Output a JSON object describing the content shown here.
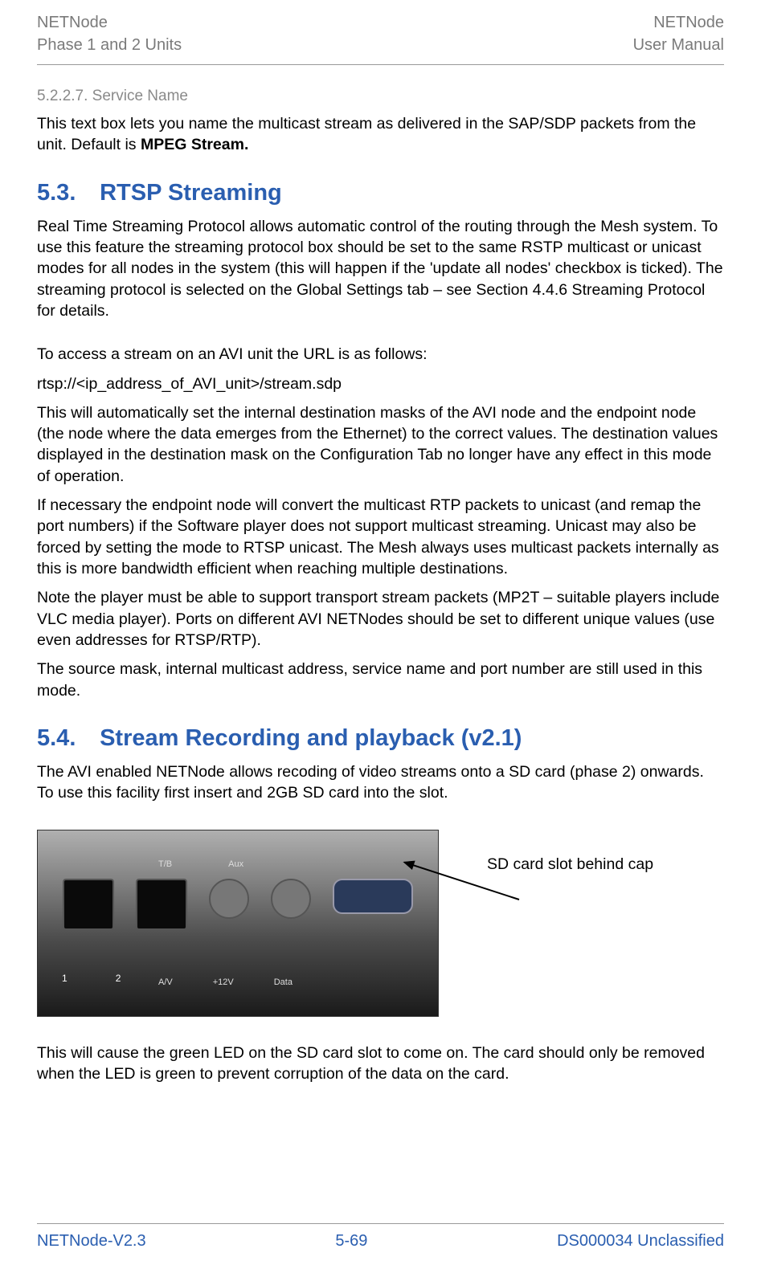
{
  "header": {
    "left_line1": "NETNode",
    "left_line2": "Phase 1 and 2 Units",
    "right_line1": "NETNode",
    "right_line2": "User Manual"
  },
  "sections": {
    "s52227": {
      "number": "5.2.2.7.",
      "title": "Service Name",
      "body": "This text box lets you name the multicast stream as delivered in the SAP/SDP packets from the unit. Default is ",
      "bold_default": "MPEG Stream."
    },
    "s53": {
      "number": "5.3.",
      "title": "RTSP Streaming",
      "p1": "Real Time Streaming Protocol allows automatic control of the routing through the Mesh system. To use this feature the streaming protocol box should be set to the same RSTP multicast or unicast modes for all nodes in the system (this will happen if the 'update all nodes' checkbox is ticked). The streaming protocol is selected on the Global Settings tab – see Section 4.4.6 Streaming Protocol for details.",
      "p2": "To access a stream on an AVI unit the URL is as follows:",
      "p3": "rtsp://<ip_address_of_AVI_unit>/stream.sdp",
      "p4": "This will automatically set the internal destination masks of the AVI node and the endpoint node (the node where the data emerges from the Ethernet) to the correct values. The destination values displayed in the destination mask on the Configuration Tab no longer have any effect in this mode of operation.",
      "p5": "If necessary the endpoint node will convert the multicast RTP packets to unicast (and remap the port numbers) if the Software player does not support multicast streaming. Unicast may also be forced by setting the mode to RTSP unicast. The Mesh always uses multicast packets internally as this is more bandwidth efficient when reaching multiple destinations.",
      "p6": "Note the player must be able to support transport stream packets (MP2T – suitable players include VLC media player). Ports on different AVI NETNodes should be set to different unique values (use even addresses for RTSP/RTP).",
      "p7": "The source mask, internal multicast address, service name and port number are still used in this mode."
    },
    "s54": {
      "number": "5.4.",
      "title": "Stream Recording and playback (v2.1)",
      "p1": "The AVI enabled NETNode allows recoding of video streams onto a SD card (phase 2) onwards. To use this facility first insert and 2GB SD card into the slot.",
      "callout": "SD card slot behind cap",
      "p2": "This will cause the green LED on the SD card slot to come on. The card should only be removed when the LED is green to prevent corruption of the data on the card."
    }
  },
  "figure": {
    "port_label_top1": "T/B",
    "port_label_top2": "Aux",
    "port_label_bottom1": "A/V",
    "port_label_bottom2": "+12V",
    "port_label_bottom3": "Data",
    "port_num1": "1",
    "port_num2": "2"
  },
  "footer": {
    "left": "NETNode-V2.3",
    "center": "5-69",
    "right": "DS000034 Unclassified"
  }
}
